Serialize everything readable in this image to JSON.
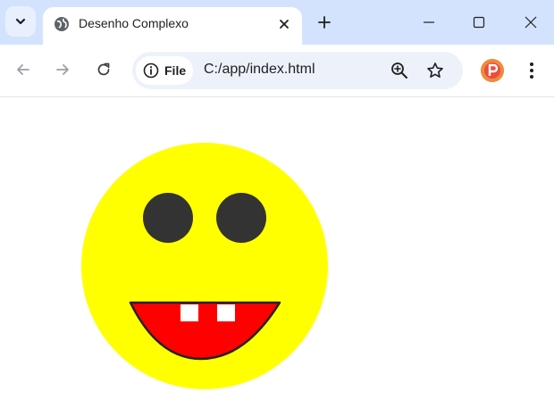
{
  "tab": {
    "title": "Desenho Complexo"
  },
  "address_bar": {
    "chip_label": "File",
    "url": "C:/app/index.html"
  },
  "icons": {
    "tab_search": "chevron-down-icon",
    "favicon": "globe-icon",
    "tab_close": "close-icon",
    "new_tab": "plus-icon",
    "minimize": "minimize-icon",
    "maximize": "maximize-icon",
    "close_window": "close-icon",
    "back": "arrow-left-icon",
    "forward": "arrow-right-icon",
    "reload": "reload-icon",
    "site_info": "info-icon",
    "zoom": "zoom-in-icon",
    "bookmark": "star-icon",
    "profile": "profile-avatar-icon",
    "menu": "kebab-menu-icon"
  },
  "colors": {
    "tabstrip": "#d3e3fd",
    "face": "#ffff00",
    "eyes": "#333333",
    "mouth": "#ff0000",
    "mouth_outline": "#222222",
    "teeth": "#ffffff"
  }
}
